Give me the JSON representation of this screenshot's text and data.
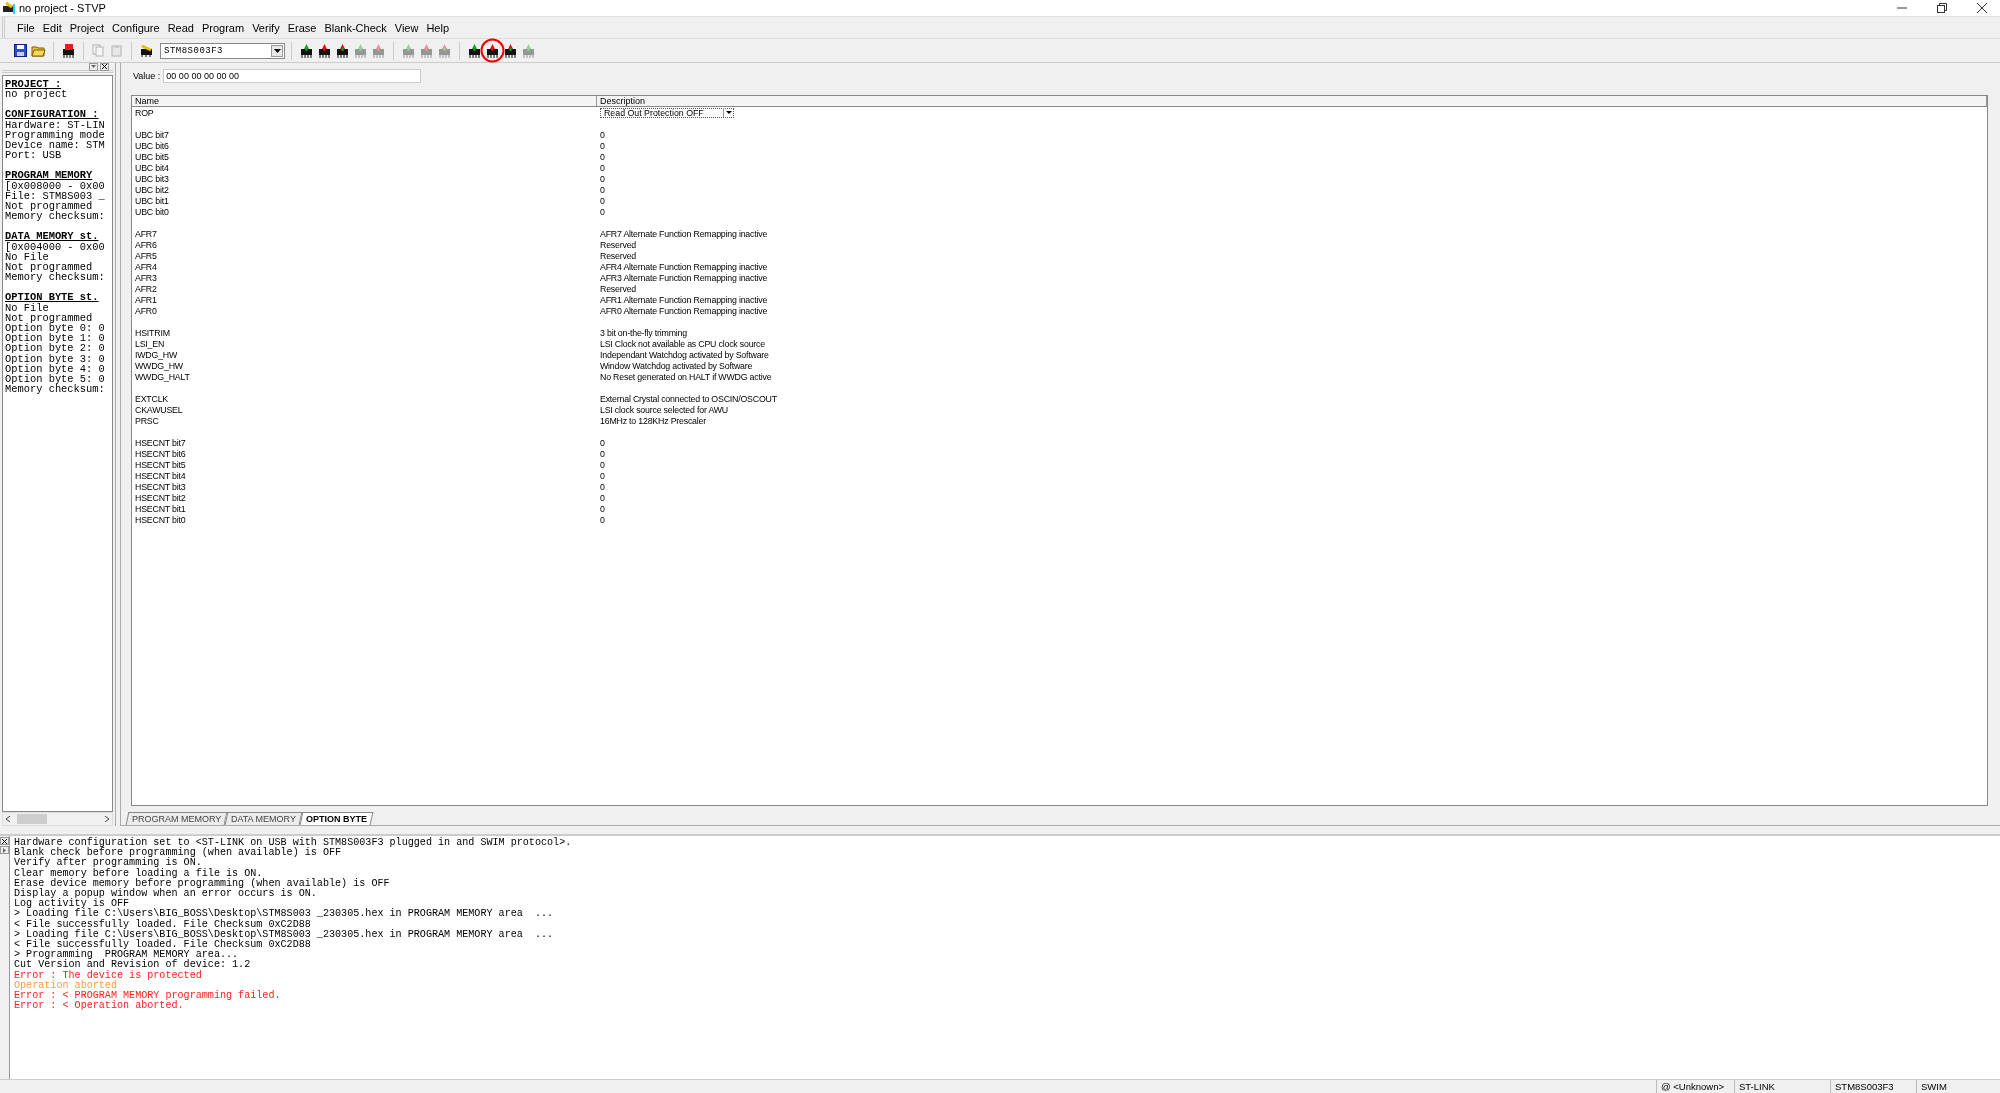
{
  "window": {
    "title": "no project - STVP"
  },
  "menu": [
    {
      "label": "File"
    },
    {
      "label": "Edit"
    },
    {
      "label": "Project"
    },
    {
      "label": "Configure"
    },
    {
      "label": "Read"
    },
    {
      "label": "Program"
    },
    {
      "label": "Verify"
    },
    {
      "label": "Erase"
    },
    {
      "label": "Blank-Check"
    },
    {
      "label": "View"
    },
    {
      "label": "Help"
    }
  ],
  "toolbar": {
    "device": "STM8S003F3",
    "groups": [
      [
        {
          "kind": "save",
          "disabled": false,
          "highlighted": false
        },
        {
          "kind": "open",
          "disabled": false,
          "highlighted": false
        }
      ],
      [
        {
          "kind": "config",
          "disabled": false,
          "highlighted": false
        }
      ],
      [
        {
          "kind": "copy",
          "disabled": true,
          "highlighted": false
        },
        {
          "kind": "paste",
          "disabled": true,
          "highlighted": false
        }
      ],
      [
        {
          "kind": "device",
          "disabled": false,
          "highlighted": false
        }
      ],
      [
        {
          "kind": "chipgreen",
          "disabled": false,
          "highlighted": false
        },
        {
          "kind": "chipred",
          "disabled": false,
          "highlighted": false
        },
        {
          "kind": "chipmixed",
          "disabled": false,
          "highlighted": false
        },
        {
          "kind": "chipgreen",
          "disabled": true,
          "highlighted": false
        },
        {
          "kind": "chipred",
          "disabled": true,
          "highlighted": false
        }
      ],
      [
        {
          "kind": "chipgreen",
          "disabled": true,
          "highlighted": false
        },
        {
          "kind": "chipred",
          "disabled": true,
          "highlighted": false
        },
        {
          "kind": "chipmixed",
          "disabled": true,
          "highlighted": false
        }
      ],
      [
        {
          "kind": "chipgreen",
          "disabled": false,
          "highlighted": false
        },
        {
          "kind": "chipred",
          "disabled": false,
          "highlighted": true
        },
        {
          "kind": "chipmixed",
          "disabled": false,
          "highlighted": false
        },
        {
          "kind": "chipgreen",
          "disabled": true,
          "highlighted": false
        }
      ]
    ]
  },
  "sidebar": {
    "sections": [
      {
        "heading": "PROJECT :",
        "lines": [
          "no project"
        ]
      },
      {
        "heading": "CONFIGURATION :",
        "lines": [
          "Hardware: ST-LIN",
          "Programming mode",
          "Device name: STM",
          "Port: USB"
        ]
      },
      {
        "heading": "PROGRAM MEMORY",
        "lines": [
          "[0x008000 - 0x00",
          "File: STM8S003 _",
          "Not programmed",
          "Memory checksum:"
        ]
      },
      {
        "heading": "DATA MEMORY st.",
        "lines": [
          "[0x004000 - 0x00",
          "No File",
          "Not programmed",
          "Memory checksum:"
        ]
      },
      {
        "heading": "OPTION BYTE st.",
        "lines": [
          "No File",
          "Not programmed",
          "Option byte 0: 0",
          "Option byte 1: 0",
          "Option byte 2: 0",
          "Option byte 3: 0",
          "Option byte 4: 0",
          "Option byte 5: 0",
          "Memory checksum:"
        ]
      }
    ]
  },
  "value_field": {
    "label": "Value :",
    "value": "00 00 00 00 00 00"
  },
  "table": {
    "columns": [
      "Name",
      "Description"
    ],
    "groups": [
      [
        {
          "kind": "dropdown",
          "name": "ROP",
          "description": "Read Out Protection OFF"
        }
      ],
      [
        {
          "kind": "text",
          "name": "UBC bit7",
          "description": "0"
        },
        {
          "kind": "text",
          "name": "UBC bit6",
          "description": "0"
        },
        {
          "kind": "text",
          "name": "UBC bit5",
          "description": "0"
        },
        {
          "kind": "text",
          "name": "UBC bit4",
          "description": "0"
        },
        {
          "kind": "text",
          "name": "UBC bit3",
          "description": "0"
        },
        {
          "kind": "text",
          "name": "UBC bit2",
          "description": "0"
        },
        {
          "kind": "text",
          "name": "UBC bit1",
          "description": "0"
        },
        {
          "kind": "text",
          "name": "UBC bit0",
          "description": "0"
        }
      ],
      [
        {
          "kind": "text",
          "name": "AFR7",
          "description": "AFR7 Alternate Function Remapping inactive"
        },
        {
          "kind": "text",
          "name": "AFR6",
          "description": "Reserved"
        },
        {
          "kind": "text",
          "name": "AFR5",
          "description": "Reserved"
        },
        {
          "kind": "text",
          "name": "AFR4",
          "description": "AFR4 Alternate Function Remapping inactive"
        },
        {
          "kind": "text",
          "name": "AFR3",
          "description": "AFR3 Alternate Function Remapping inactive"
        },
        {
          "kind": "text",
          "name": "AFR2",
          "description": "Reserved"
        },
        {
          "kind": "text",
          "name": "AFR1",
          "description": "AFR1 Alternate Function Remapping inactive"
        },
        {
          "kind": "text",
          "name": "AFR0",
          "description": "AFR0 Alternate Function Remapping inactive"
        }
      ],
      [
        {
          "kind": "text",
          "name": "HSITRIM",
          "description": "3 bit on-the-fly trimming"
        },
        {
          "kind": "text",
          "name": "LSI_EN",
          "description": "LSI Clock not available as CPU clock source"
        },
        {
          "kind": "text",
          "name": "IWDG_HW",
          "description": "Independant Watchdog activated by Software"
        },
        {
          "kind": "text",
          "name": "WWDG_HW",
          "description": "Window Watchdog activated by Software"
        },
        {
          "kind": "text",
          "name": "WWDG_HALT",
          "description": "No Reset generated on HALT if WWDG active"
        }
      ],
      [
        {
          "kind": "text",
          "name": "EXTCLK",
          "description": "External Crystal connected to OSCIN/OSCOUT"
        },
        {
          "kind": "text",
          "name": "CKAWUSEL",
          "description": "LSI clock source selected for AWU"
        },
        {
          "kind": "text",
          "name": "PRSC",
          "description": "16MHz to 128KHz Prescaler"
        }
      ],
      [
        {
          "kind": "text",
          "name": "HSECNT bit7",
          "description": "0"
        },
        {
          "kind": "text",
          "name": "HSECNT bit6",
          "description": "0"
        },
        {
          "kind": "text",
          "name": "HSECNT bit5",
          "description": "0"
        },
        {
          "kind": "text",
          "name": "HSECNT bit4",
          "description": "0"
        },
        {
          "kind": "text",
          "name": "HSECNT bit3",
          "description": "0"
        },
        {
          "kind": "text",
          "name": "HSECNT bit2",
          "description": "0"
        },
        {
          "kind": "text",
          "name": "HSECNT bit1",
          "description": "0"
        },
        {
          "kind": "text",
          "name": "HSECNT bit0",
          "description": "0"
        }
      ]
    ]
  },
  "tabs": [
    {
      "label": "PROGRAM MEMORY",
      "selected": false
    },
    {
      "label": "DATA MEMORY",
      "selected": false
    },
    {
      "label": "OPTION BYTE",
      "selected": true
    }
  ],
  "log": [
    {
      "kind": "info",
      "text": "Hardware configuration set to <ST-LINK on USB with STM8S003F3 plugged in and SWIM protocol>."
    },
    {
      "kind": "info",
      "text": "Blank check before programming (when available) is OFF"
    },
    {
      "kind": "info",
      "text": "Verify after programming is ON."
    },
    {
      "kind": "info",
      "text": "Clear memory before loading a file is ON."
    },
    {
      "kind": "info",
      "text": "Erase device memory before programming (when available) is OFF"
    },
    {
      "kind": "info",
      "text": "Display a popup window when an error occurs is ON."
    },
    {
      "kind": "info",
      "text": "Log activity is OFF"
    },
    {
      "kind": "info",
      "text": "> Loading file C:\\Users\\BIG_BOSS\\Desktop\\STM8S003 _230305.hex in PROGRAM MEMORY area  ..."
    },
    {
      "kind": "info",
      "text": "< File successfully loaded. File Checksum 0xC2D88"
    },
    {
      "kind": "info",
      "text": "> Loading file C:\\Users\\BIG_BOSS\\Desktop\\STM8S003 _230305.hex in PROGRAM MEMORY area  ..."
    },
    {
      "kind": "info",
      "text": "< File successfully loaded. File Checksum 0xC2D88"
    },
    {
      "kind": "info",
      "text": "> Programming  PROGRAM MEMORY area..."
    },
    {
      "kind": "info",
      "text": "Cut Version and Revision of device: 1.2"
    },
    {
      "kind": "error",
      "text": "Error : The device is protected"
    },
    {
      "kind": "warning",
      "text": "Operation aborted"
    },
    {
      "kind": "error",
      "text": "Error : < PROGRAM MEMORY programming failed."
    },
    {
      "kind": "error",
      "text": "Error : < Operation aborted."
    }
  ],
  "status_bar": [
    "@ <Unknown>",
    "ST-LINK",
    "STM8S003F3",
    "SWIM"
  ]
}
